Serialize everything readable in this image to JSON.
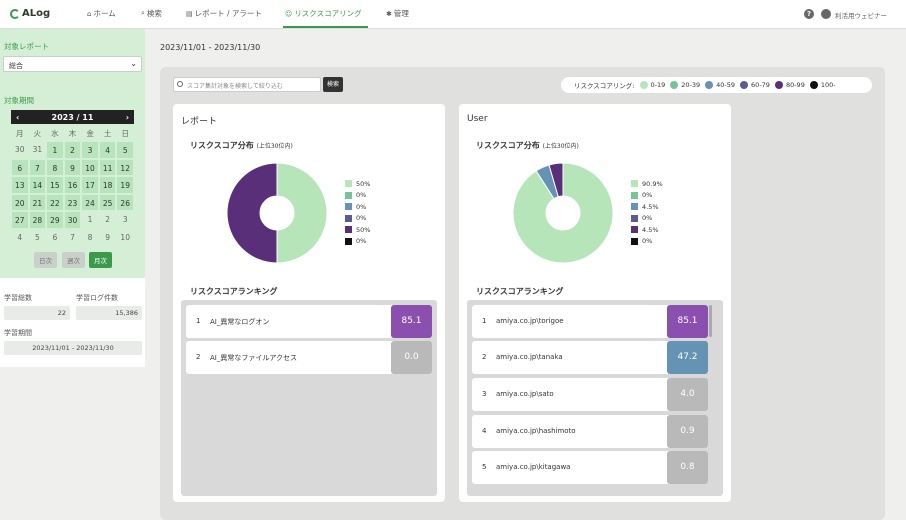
{
  "header": {
    "logo": "ALog",
    "nav": [
      {
        "icon": "home-icon",
        "label": "ホーム"
      },
      {
        "icon": "search-icon",
        "label": "検索"
      },
      {
        "icon": "report-icon",
        "label": "レポート / アラート"
      },
      {
        "icon": "risk-icon",
        "label": "リスクスコアリング"
      },
      {
        "icon": "gear-icon",
        "label": "管理"
      }
    ],
    "help": "?",
    "user": "利活用ウェビナー"
  },
  "sidebar": {
    "target_label": "対象レポート",
    "target_value": "総合",
    "period_label": "対象期間",
    "calendar": {
      "month": "2023 / 11",
      "prev": "‹",
      "next": "›",
      "dow": [
        "月",
        "火",
        "水",
        "木",
        "金",
        "土",
        "日"
      ],
      "days": [
        [
          "30",
          "31",
          "1",
          "2",
          "3",
          "4",
          "5"
        ],
        [
          "6",
          "7",
          "8",
          "9",
          "10",
          "11",
          "12"
        ],
        [
          "13",
          "14",
          "15",
          "16",
          "17",
          "18",
          "19"
        ],
        [
          "20",
          "21",
          "22",
          "23",
          "24",
          "25",
          "26"
        ],
        [
          "27",
          "28",
          "29",
          "30",
          "1",
          "2",
          "3"
        ],
        [
          "4",
          "5",
          "6",
          "7",
          "8",
          "9",
          "10"
        ]
      ]
    },
    "modes": [
      "日次",
      "週次",
      "月次"
    ],
    "stats": {
      "total_label": "学習総数",
      "total_value": "22",
      "logs_label": "学習ログ件数",
      "logs_value": "15,386",
      "period_label": "学習期間",
      "period_value": "2023/11/01 - 2023/11/30"
    }
  },
  "main": {
    "date_range": "2023/11/01 - 2023/11/30",
    "search_placeholder": "スコア集計対象を検索して絞り込む",
    "search_button": "検索",
    "legend_title": "リスクスコアリング:",
    "legend": [
      {
        "label": "0-19",
        "color": "#b5e5b8"
      },
      {
        "label": "20-39",
        "color": "#79c39a"
      },
      {
        "label": "40-59",
        "color": "#6593b3"
      },
      {
        "label": "60-79",
        "color": "#5b5a94"
      },
      {
        "label": "80-99",
        "color": "#5a2f7a"
      },
      {
        "label": "100-",
        "color": "#111111"
      }
    ]
  },
  "cards": [
    {
      "title": "レポート",
      "dist_title": "リスクスコア分布",
      "dist_sub": "(上位30位内)",
      "pie": [
        50,
        0,
        0,
        0,
        50,
        0
      ],
      "pie_labels": [
        "50%",
        "0%",
        "0%",
        "0%",
        "50%",
        "0%"
      ],
      "ranking_title": "リスクスコアランキング",
      "ranking": [
        {
          "num": "1",
          "name": "AI_異常なログオン",
          "score": "85.1",
          "color": "#8a4faf"
        },
        {
          "num": "2",
          "name": "AI_異常なファイルアクセス",
          "score": "0.0",
          "color": "#b9b9b9"
        }
      ]
    },
    {
      "title": "User",
      "dist_title": "リスクスコア分布",
      "dist_sub": "(上位30位内)",
      "pie": [
        90.9,
        0,
        4.5,
        0,
        4.5,
        0
      ],
      "pie_labels": [
        "90.9%",
        "0%",
        "4.5%",
        "0%",
        "4.5%",
        "0%"
      ],
      "ranking_title": "リスクスコアランキング",
      "ranking": [
        {
          "num": "1",
          "name": "amiya.co.jp\\torigoe",
          "score": "85.1",
          "color": "#8a4faf"
        },
        {
          "num": "2",
          "name": "amiya.co.jp\\tanaka",
          "score": "47.2",
          "color": "#6593b3"
        },
        {
          "num": "3",
          "name": "amiya.co.jp\\sato",
          "score": "4.0",
          "color": "#b9b9b9"
        },
        {
          "num": "4",
          "name": "amiya.co.jp\\hashimoto",
          "score": "0.9",
          "color": "#b9b9b9"
        },
        {
          "num": "5",
          "name": "amiya.co.jp\\kitagawa",
          "score": "0.8",
          "color": "#b9b9b9"
        }
      ]
    }
  ]
}
